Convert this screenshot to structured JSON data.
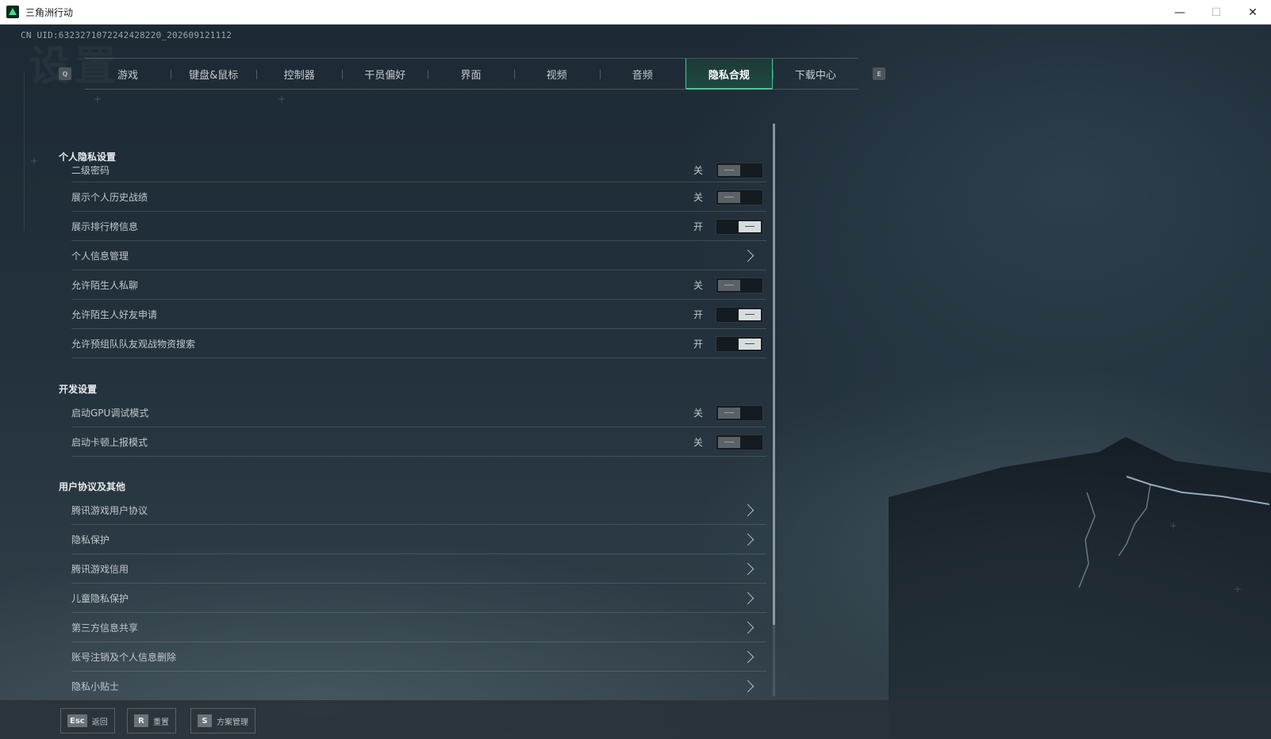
{
  "window": {
    "title": "三角洲行动",
    "minimize": "—",
    "maximize": "☐",
    "close": "✕"
  },
  "header": {
    "uid": "CN UID:63232710722424282​20_202609121112",
    "watermark": "设置"
  },
  "tabs": {
    "key_left": "Q",
    "key_right": "E",
    "items": [
      "游戏",
      "键盘&鼠标",
      "控制器",
      "干员偏好",
      "界面",
      "视频",
      "音频",
      "隐私合规",
      "下载中心"
    ],
    "active": "隐私合规"
  },
  "sections": {
    "privacy": {
      "title": "个人隐私设置",
      "rows": [
        {
          "label": "二级密码",
          "state": "关",
          "on": false
        },
        {
          "label": "展示个人历史战绩",
          "state": "关",
          "on": false
        },
        {
          "label": "展示排行榜信息",
          "state": "开",
          "on": true
        },
        {
          "label": "个人信息管理"
        },
        {
          "label": "允许陌生人私聊",
          "state": "关",
          "on": false
        },
        {
          "label": "允许陌生人好友申请",
          "state": "开",
          "on": true
        },
        {
          "label": "允许预组队队友观战物资搜索",
          "state": "开",
          "on": true
        }
      ]
    },
    "dev": {
      "title": "开发设置",
      "rows": [
        {
          "label": "启动GPU调试模式",
          "state": "关",
          "on": false
        },
        {
          "label": "启动卡顿上报模式",
          "state": "关",
          "on": false
        }
      ]
    },
    "agreements": {
      "title": "用户协议及其他",
      "rows": [
        {
          "label": "腾讯游戏用户协议"
        },
        {
          "label": "隐私保护"
        },
        {
          "label": "腾讯游戏信用"
        },
        {
          "label": "儿童隐私保护"
        },
        {
          "label": "第三方信息共享"
        },
        {
          "label": "账号注销及个人信息删除"
        },
        {
          "label": "隐私小贴士"
        }
      ]
    }
  },
  "footer": {
    "back": {
      "key": "Esc",
      "label": "返回"
    },
    "reset": {
      "key": "R",
      "label": "重置"
    },
    "preset": {
      "key": "S",
      "label": "方案管理"
    }
  },
  "colors": {
    "accent": "#38d08f",
    "panel_bg": "#1d2a35"
  }
}
